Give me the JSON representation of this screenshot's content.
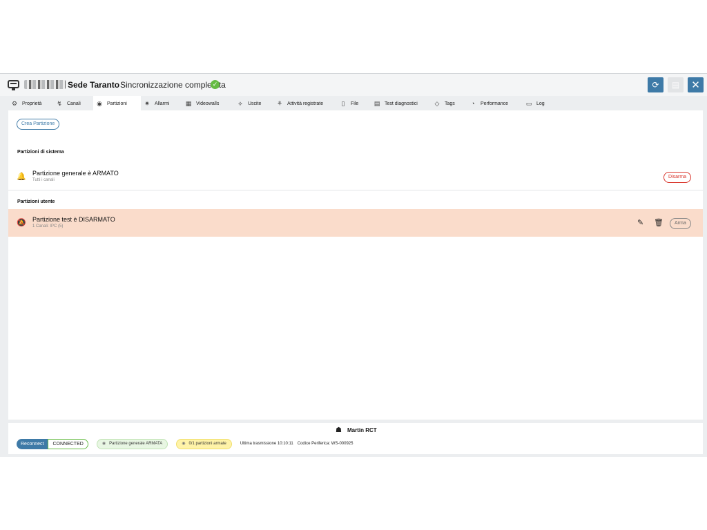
{
  "header": {
    "device_icon": "device-icon",
    "device_name_blurred": "",
    "site_name": "Sede Taranto",
    "sync_status": "Sincronizzazione completata",
    "sync_ok_glyph": "✓",
    "refresh_glyph": "⟳",
    "save_glyph": "▤",
    "close_glyph": "✕"
  },
  "tabs": [
    {
      "icon": "⚙",
      "label": "Proprietà"
    },
    {
      "icon": "↯",
      "label": "Canali"
    },
    {
      "icon": "◉",
      "label": "Partizioni"
    },
    {
      "icon": "✷",
      "label": "Allarmi"
    },
    {
      "icon": "▦",
      "label": "Videowalls"
    },
    {
      "icon": "⟡",
      "label": "Uscite"
    },
    {
      "icon": "⚘",
      "label": "Attività registrate"
    },
    {
      "icon": "▯",
      "label": "File"
    },
    {
      "icon": "▤",
      "label": "Test diagnostici"
    },
    {
      "icon": "◇",
      "label": "Tags"
    },
    {
      "icon": "◔",
      "label": "Performance"
    },
    {
      "icon": "▭",
      "label": "Log"
    }
  ],
  "active_tab": "Partizioni",
  "content": {
    "create_button": "Crea Partizione",
    "system_section_title": "Partizioni di sistema",
    "system_partition": {
      "icon": "bell-icon",
      "glyph": "🔔",
      "title": "Partizione generale è ARMATO",
      "subtitle": "Tutti i canali",
      "action": "Disarma"
    },
    "user_section_title": "Partizioni utente",
    "user_partition": {
      "icon": "bell-slash-icon",
      "glyph": "🔕",
      "title": "Partizione test è DISARMATO",
      "subtitle": "1 Canali: IPC (5)",
      "edit_glyph": "✎",
      "trash_glyph": "🗑",
      "action": "Arma"
    }
  },
  "footer": {
    "user_glyph": "☗",
    "user_name": "Martin RCT",
    "reconnect": "Reconnect",
    "connection_status": "CONNECTED",
    "badge_general": "Partizione generale ARMATA",
    "badge_armed": "0/1 partizioni armate",
    "badge_glyph": "◉",
    "last_transmission": "Ultima trasmissione 10:10:11",
    "device_code": "Codice Periferica: WS-000925"
  },
  "colors": {
    "accent": "#3e7aa7",
    "danger": "#d9342b",
    "ok": "#66bb44",
    "disarmed_row": "#fadccb",
    "warning_badge": "#fff3a8"
  }
}
